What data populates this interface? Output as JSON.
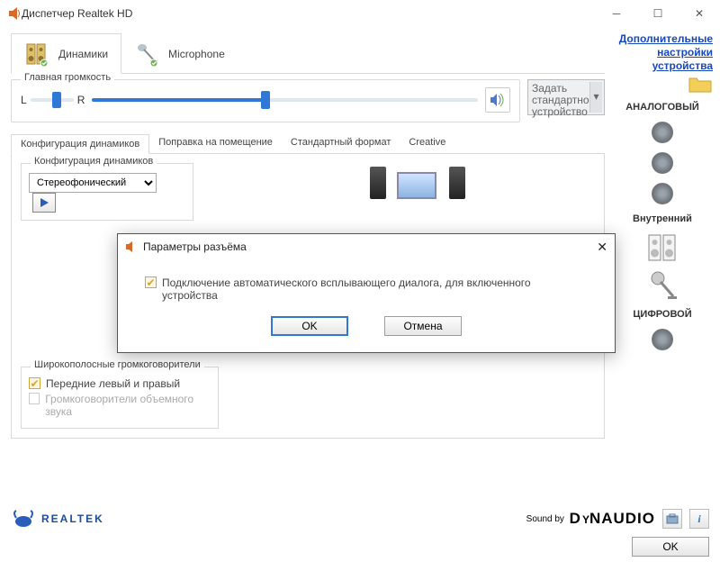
{
  "window": {
    "title": "Диспетчер Realtek HD"
  },
  "tabs": {
    "speakers": "Динамики",
    "microphone": "Microphone"
  },
  "volume": {
    "group_title": "Главная громкость",
    "left": "L",
    "right": "R",
    "default_device": "Задать стандартное устройство"
  },
  "subtabs": {
    "config": "Конфигурация динамиков",
    "room": "Поправка на помещение",
    "format": "Стандартный формат",
    "creative": "Creative"
  },
  "config": {
    "group_title": "Конфигурация динамиков",
    "select_value": "Стереофонический"
  },
  "wideband": {
    "group_title": "Широкополосные громкоговорители",
    "front": "Передние левый и правый",
    "surround": "Громкоговорители объемного звука"
  },
  "right": {
    "adv_link": "Дополнительные настройки устройства",
    "analog": "АНАЛОГОВЫЙ",
    "internal": "Внутренний",
    "digital": "ЦИФРОВОЙ"
  },
  "footer": {
    "realtek": "REALTEK",
    "soundby": "Sound by",
    "dynaudio": "DYNAUDIO",
    "ok": "OK"
  },
  "modal": {
    "title": "Параметры разъёма",
    "checkbox": "Подключение автоматического всплывающего диалога, для включенного устройства",
    "ok": "OK",
    "cancel": "Отмена"
  }
}
